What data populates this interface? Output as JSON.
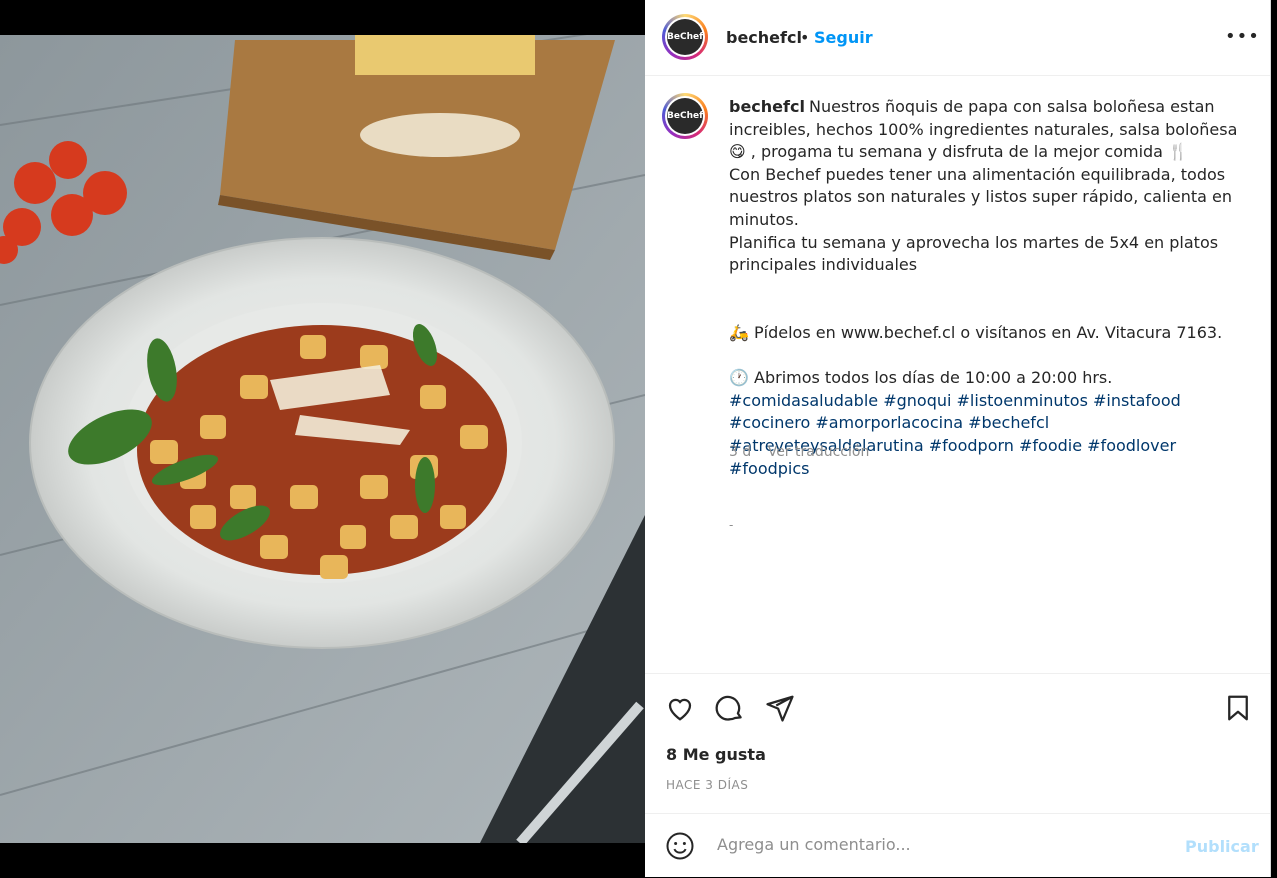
{
  "post": {
    "username": "bechefcl",
    "follow_label": "Seguir",
    "separator": "•",
    "more_label": "•••",
    "avatar_text": "BeChef"
  },
  "caption": {
    "username": "bechefcl",
    "line1": "Nuestros ñoquis de papa con salsa boloñesa estan increibles, hechos 100% ingredientes naturales, salsa boloñesa😋 , progama tu semana y disfruta de la mejor comida 🍴",
    "line2": "Con Bechef puedes tener una alimentación equilibrada, todos nuestros platos son naturales y listos super rápido, calienta en minutos.",
    "line3": "Planifica tu semana y aprovecha los martes de 5x4 en platos principales individuales",
    "line4": "🛵 Pídelos en www.bechef.cl o visítanos en Av. Vitacura 7163.",
    "line5": "🕐 Abrimos todos los días de 10:00 a 20:00 hrs.",
    "hashtags": "#comidasaludable #gnoqui #listoenminutos #instafood #cocinero #amorporlacocina #bechefcl #atreveteysaldelarutina #foodporn #foodie #foodlover #foodpics",
    "age": "3 d",
    "translate": "Ver traducción",
    "dash": "-"
  },
  "actions": {
    "likes": "8 Me gusta",
    "time": "HACE 3 DÍAS"
  },
  "comment": {
    "placeholder": "Agrega un comentario...",
    "publish": "Publicar"
  },
  "colors": {
    "link_blue": "#0095f6",
    "hashtag": "#00376b",
    "muted": "#8e8e8e",
    "publish_disabled": "#b2dffc"
  }
}
